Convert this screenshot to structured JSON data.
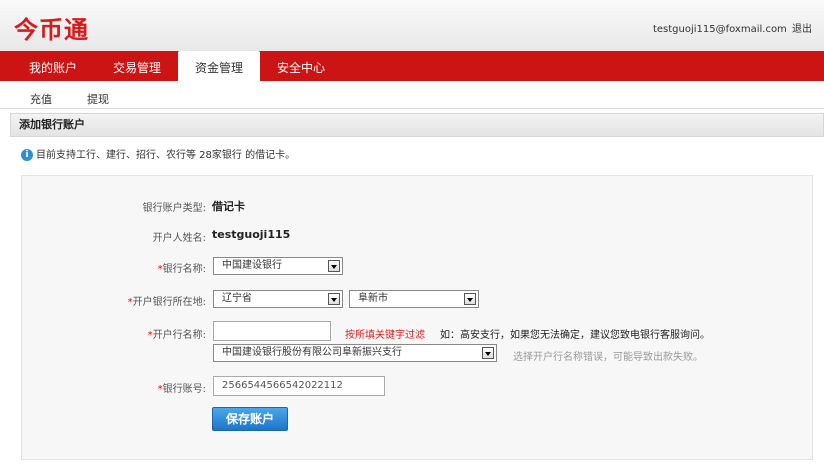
{
  "header": {
    "logo": "今币通",
    "user_email": "testguoji115@foxmail.com",
    "logout_label": "退出"
  },
  "nav": {
    "items": [
      {
        "label": "我的账户"
      },
      {
        "label": "交易管理"
      },
      {
        "label": "资金管理",
        "active": true
      },
      {
        "label": "安全中心"
      }
    ]
  },
  "subnav": {
    "items": [
      {
        "label": "充值"
      },
      {
        "label": "提现"
      }
    ]
  },
  "panel": {
    "title": "添加银行账户"
  },
  "notice": {
    "icon": "info-icon",
    "text": "目前支持工行、建行、招行、农行等 28家银行 的借记卡。"
  },
  "form": {
    "account_type": {
      "label": "银行账户类型:",
      "value": "借记卡"
    },
    "holder_name": {
      "label": "开户人姓名:",
      "value": "testguoji115"
    },
    "bank_name": {
      "required": "*",
      "label": "银行名称:",
      "value": "中国建设银行"
    },
    "bank_location": {
      "required": "*",
      "label": "开户银行所在地:",
      "province": "辽宁省",
      "city": "阜新市"
    },
    "branch_name": {
      "required": "*",
      "label": "开户行名称:",
      "input_value": "",
      "hint_red": "按所填关键字过滤",
      "hint_dark": "如：高安支行，如果您无法确定，建议您致电银行客服询问。",
      "select_value": "中国建设银行股份有限公司阜新振兴支行",
      "select_hint": "选择开户行名称错误，可能导致出款失败。"
    },
    "account_number": {
      "required": "*",
      "label": "银行账号:",
      "value": "2566544566542022112"
    },
    "save_label": "保存账户"
  },
  "colors": {
    "brand_red": "#cc1414",
    "button_blue": "#1d75c9"
  }
}
